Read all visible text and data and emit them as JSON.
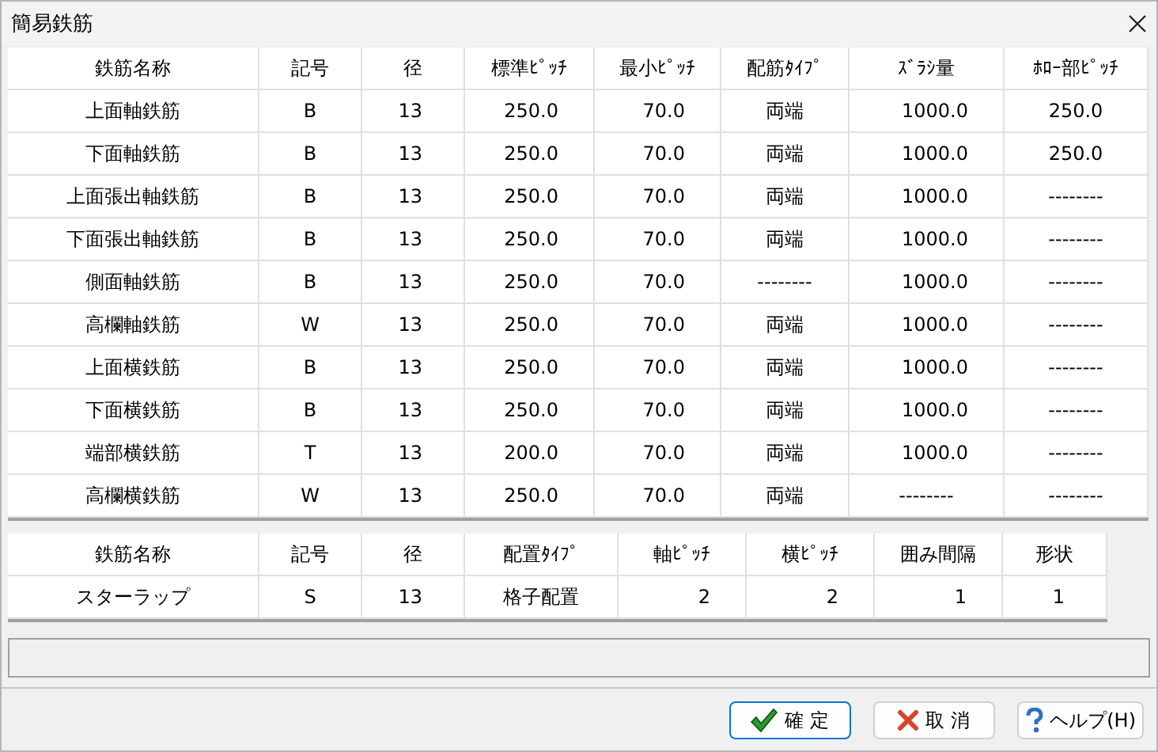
{
  "window": {
    "title": "簡易鉄筋"
  },
  "main_table": {
    "columns": [
      "鉄筋名称",
      "記号",
      "径",
      "標準ﾋﾟｯﾁ",
      "最小ﾋﾟｯﾁ",
      "配筋ﾀｲﾌﾟ",
      "ｽﾞﾗｼ量",
      "ﾎﾛｰ部ﾋﾟｯﾁ"
    ],
    "rows": [
      [
        "上面軸鉄筋",
        "B",
        "13",
        "250.0",
        "70.0",
        "両端",
        "1000.0",
        "250.0"
      ],
      [
        "下面軸鉄筋",
        "B",
        "13",
        "250.0",
        "70.0",
        "両端",
        "1000.0",
        "250.0"
      ],
      [
        "上面張出軸鉄筋",
        "B",
        "13",
        "250.0",
        "70.0",
        "両端",
        "1000.0",
        "--------"
      ],
      [
        "下面張出軸鉄筋",
        "B",
        "13",
        "250.0",
        "70.0",
        "両端",
        "1000.0",
        "--------"
      ],
      [
        "側面軸鉄筋",
        "B",
        "13",
        "250.0",
        "70.0",
        "--------",
        "1000.0",
        "--------"
      ],
      [
        "高欄軸鉄筋",
        "W",
        "13",
        "250.0",
        "70.0",
        "両端",
        "1000.0",
        "--------"
      ],
      [
        "上面横鉄筋",
        "B",
        "13",
        "250.0",
        "70.0",
        "両端",
        "1000.0",
        "--------"
      ],
      [
        "下面横鉄筋",
        "B",
        "13",
        "250.0",
        "70.0",
        "両端",
        "1000.0",
        "--------"
      ],
      [
        "端部横鉄筋",
        "T",
        "13",
        "200.0",
        "70.0",
        "両端",
        "1000.0",
        "--------"
      ],
      [
        "高欄横鉄筋",
        "W",
        "13",
        "250.0",
        "70.0",
        "両端",
        "--------",
        "--------"
      ]
    ]
  },
  "stirrup_table": {
    "columns": [
      "鉄筋名称",
      "記号",
      "径",
      "配置ﾀｲﾌﾟ",
      "軸ﾋﾟｯﾁ",
      "横ﾋﾟｯﾁ",
      "囲み間隔",
      "形状"
    ],
    "rows": [
      [
        "スターラップ",
        "S",
        "13",
        "格子配置",
        "2",
        "2",
        "1",
        "1"
      ]
    ]
  },
  "buttons": [
    {
      "kind": "ok",
      "label": "確 定"
    },
    {
      "kind": "cancel",
      "label": "取 消"
    },
    {
      "kind": "help",
      "label": "ヘルプ(H)"
    }
  ]
}
